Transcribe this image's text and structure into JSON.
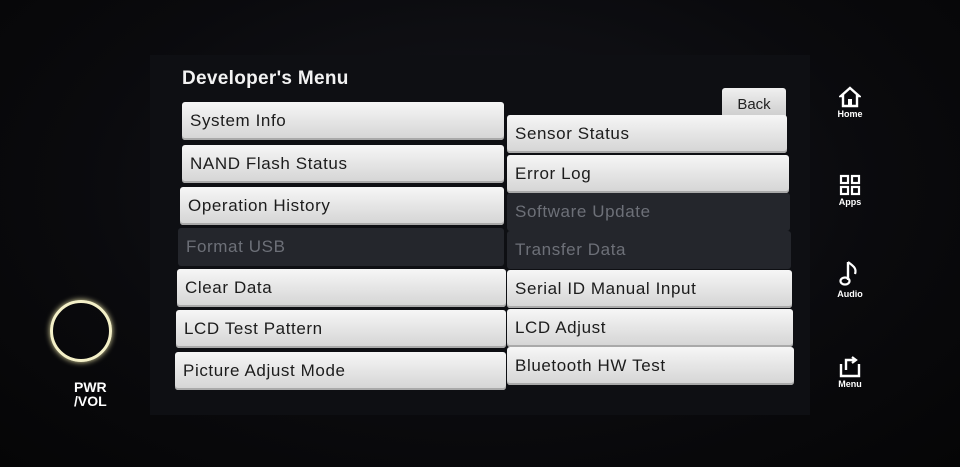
{
  "title": "Developer's Menu",
  "back_label": "Back",
  "left_buttons": [
    {
      "label": "System Info",
      "enabled": true
    },
    {
      "label": "NAND Flash Status",
      "enabled": true
    },
    {
      "label": "Operation History",
      "enabled": true
    },
    {
      "label": "Format USB",
      "enabled": false
    },
    {
      "label": "Clear Data",
      "enabled": true
    },
    {
      "label": "LCD Test Pattern",
      "enabled": true
    },
    {
      "label": "Picture Adjust Mode",
      "enabled": true
    }
  ],
  "right_buttons": [
    {
      "label": "Sensor Status",
      "enabled": true
    },
    {
      "label": "Error Log",
      "enabled": true
    },
    {
      "label": "Software Update",
      "enabled": false
    },
    {
      "label": "Transfer Data",
      "enabled": false
    },
    {
      "label": "Serial ID Manual Input",
      "enabled": true
    },
    {
      "label": "LCD Adjust",
      "enabled": true
    },
    {
      "label": "Bluetooth HW Test",
      "enabled": true
    }
  ],
  "side_buttons": [
    {
      "label": "Home",
      "icon": "home-icon"
    },
    {
      "label": "Apps",
      "icon": "apps-icon"
    },
    {
      "label": "Audio",
      "icon": "audio-icon"
    },
    {
      "label": "Menu",
      "icon": "menu-icon"
    }
  ],
  "pwr_label_line1": "PWR",
  "pwr_label_line2": "/VOL"
}
